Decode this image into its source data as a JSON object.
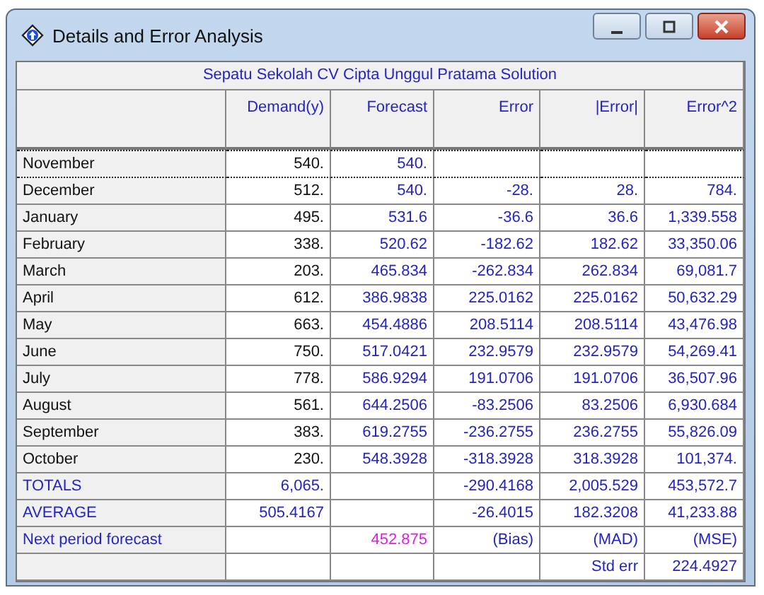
{
  "window": {
    "title": "Details and Error Analysis"
  },
  "table": {
    "title": "Sepatu Sekolah CV Cipta Unggul Pratama Solution",
    "columns": [
      "Demand(y)",
      "Forecast",
      "Error",
      "|Error|",
      "Error^2"
    ],
    "rows": [
      {
        "kind": "period",
        "selected": true,
        "label": "November",
        "cells": [
          "540.",
          "540.",
          null,
          null,
          null
        ]
      },
      {
        "kind": "period",
        "selected": false,
        "label": "December",
        "cells": [
          "512.",
          "540.",
          "-28.",
          "28.",
          "784."
        ]
      },
      {
        "kind": "period",
        "selected": false,
        "label": "January",
        "cells": [
          "495.",
          "531.6",
          "-36.6",
          "36.6",
          "1,339.558"
        ]
      },
      {
        "kind": "period",
        "selected": false,
        "label": "February",
        "cells": [
          "338.",
          "520.62",
          "-182.62",
          "182.62",
          "33,350.06"
        ]
      },
      {
        "kind": "period",
        "selected": false,
        "label": "March",
        "cells": [
          "203.",
          "465.834",
          "-262.834",
          "262.834",
          "69,081.7"
        ]
      },
      {
        "kind": "period",
        "selected": false,
        "label": "April",
        "cells": [
          "612.",
          "386.9838",
          "225.0162",
          "225.0162",
          "50,632.29"
        ]
      },
      {
        "kind": "period",
        "selected": false,
        "label": "May",
        "cells": [
          "663.",
          "454.4886",
          "208.5114",
          "208.5114",
          "43,476.98"
        ]
      },
      {
        "kind": "period",
        "selected": false,
        "label": "June",
        "cells": [
          "750.",
          "517.0421",
          "232.9579",
          "232.9579",
          "54,269.41"
        ]
      },
      {
        "kind": "period",
        "selected": false,
        "label": "July",
        "cells": [
          "778.",
          "586.9294",
          "191.0706",
          "191.0706",
          "36,507.96"
        ]
      },
      {
        "kind": "period",
        "selected": false,
        "label": "August",
        "cells": [
          "561.",
          "644.2506",
          "-83.2506",
          "83.2506",
          "6,930.684"
        ]
      },
      {
        "kind": "period",
        "selected": false,
        "label": "September",
        "cells": [
          "383.",
          "619.2755",
          "-236.2755",
          "236.2755",
          "55,826.09"
        ]
      },
      {
        "kind": "period",
        "selected": false,
        "label": "October",
        "cells": [
          "230.",
          "548.3928",
          "-318.3928",
          "318.3928",
          "101,374."
        ]
      },
      {
        "kind": "summary",
        "selected": false,
        "label": "TOTALS",
        "cells": [
          "6,065.",
          null,
          "-290.4168",
          "2,005.529",
          "453,572.7"
        ]
      },
      {
        "kind": "summary",
        "selected": false,
        "label": "AVERAGE",
        "cells": [
          "505.4167",
          null,
          "-26.4015",
          "182.3208",
          "41,233.88"
        ]
      },
      {
        "kind": "next",
        "selected": false,
        "label": "Next period forecast",
        "cells": [
          null,
          "452.875",
          "(Bias)",
          "(MAD)",
          "(MSE)"
        ]
      },
      {
        "kind": "summary",
        "selected": false,
        "label": null,
        "cells": [
          null,
          null,
          null,
          "Std err",
          "224.4927"
        ]
      }
    ]
  }
}
